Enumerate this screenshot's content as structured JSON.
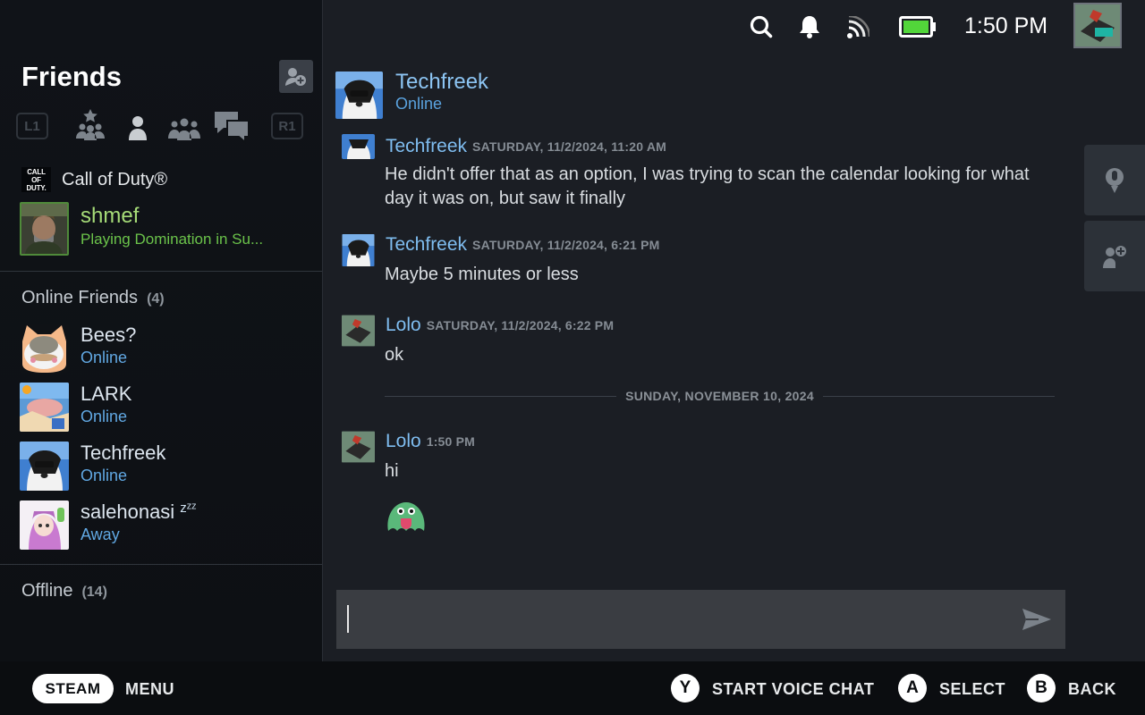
{
  "status_bar": {
    "time": "1:50 PM",
    "icons": [
      "search-icon",
      "bell-icon",
      "wifi-icon",
      "battery-icon"
    ]
  },
  "sidebar": {
    "title": "Friends",
    "shoulder_left": "L1",
    "shoulder_right": "R1",
    "filter_icons": [
      "favorites-icon",
      "friend-icon",
      "group-icon",
      "chat-icon"
    ],
    "game": {
      "logo_line1": "CALL",
      "logo_line2": "OF",
      "logo_line3": "DUTY.",
      "name": "Call of Duty®"
    },
    "ingame_friend": {
      "name": "shmef",
      "status": "Playing Domination in Su..."
    },
    "online_section": {
      "label": "Online Friends",
      "count": "(4)"
    },
    "online_friends": [
      {
        "name": "Bees?",
        "status": "Online"
      },
      {
        "name": "LARK",
        "status": "Online"
      },
      {
        "name": "Techfreek",
        "status": "Online"
      },
      {
        "name": "salehonasi",
        "status": "Away",
        "badge": "zᶻᶻ"
      }
    ],
    "offline_section": {
      "label": "Offline",
      "count": "(14)"
    }
  },
  "chat": {
    "partner": {
      "name": "Techfreek",
      "status": "Online"
    },
    "messages": [
      {
        "author": "Techfreek",
        "time": "SATURDAY, 11/2/2024, 11:20 AM",
        "text": "He didn't offer that as an option, I was trying to scan the calendar looking for what day it was on, but saw it finally"
      },
      {
        "author": "Techfreek",
        "time": "SATURDAY, 11/2/2024, 6:21 PM",
        "text": "Maybe 5 minutes or less"
      },
      {
        "author": "Lolo",
        "time": "SATURDAY, 11/2/2024, 6:22 PM",
        "text": "ok"
      },
      {
        "author": "Lolo",
        "time": "1:50 PM",
        "text": "hi"
      }
    ],
    "date_separator": "SUNDAY, NOVEMBER 10, 2024",
    "composer_value": ""
  },
  "bottom_bar": {
    "steam_label": "STEAM",
    "menu_label": "MENU",
    "y_button": "Y",
    "y_label": "START VOICE CHAT",
    "a_button": "A",
    "a_label": "SELECT",
    "b_button": "B",
    "b_label": "BACK"
  },
  "colors": {
    "online_blue": "#61a8e3",
    "ingame_green": "#6bc34a",
    "background": "#1b1e24"
  }
}
